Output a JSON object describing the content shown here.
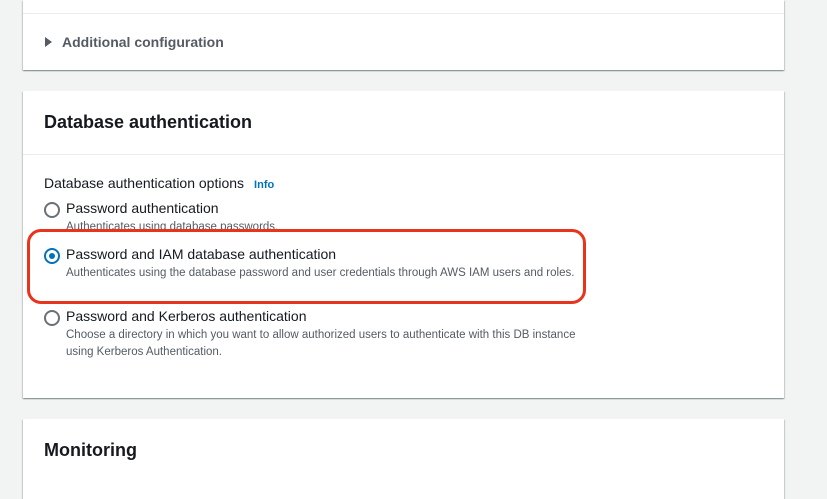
{
  "top_panel": {
    "additional_configuration_label": "Additional configuration"
  },
  "auth_panel": {
    "title": "Database authentication",
    "options_label": "Database authentication options",
    "info_link": "Info",
    "selected_option": "Password and IAM database authentication",
    "options": [
      {
        "label": "Password authentication",
        "description": "Authenticates using database passwords."
      },
      {
        "label": "Password and IAM database authentication",
        "description": "Authenticates using the database password and user credentials through AWS IAM users and roles."
      },
      {
        "label": "Password and Kerberos authentication",
        "description": "Choose a directory in which you want to allow authorized users to authenticate with this DB instance using Kerberos Authentication."
      }
    ]
  },
  "monitoring_panel": {
    "title": "Monitoring"
  },
  "colors": {
    "accent": "#0073bb",
    "highlight": "#e8341c",
    "background": "#f2f3f3"
  }
}
